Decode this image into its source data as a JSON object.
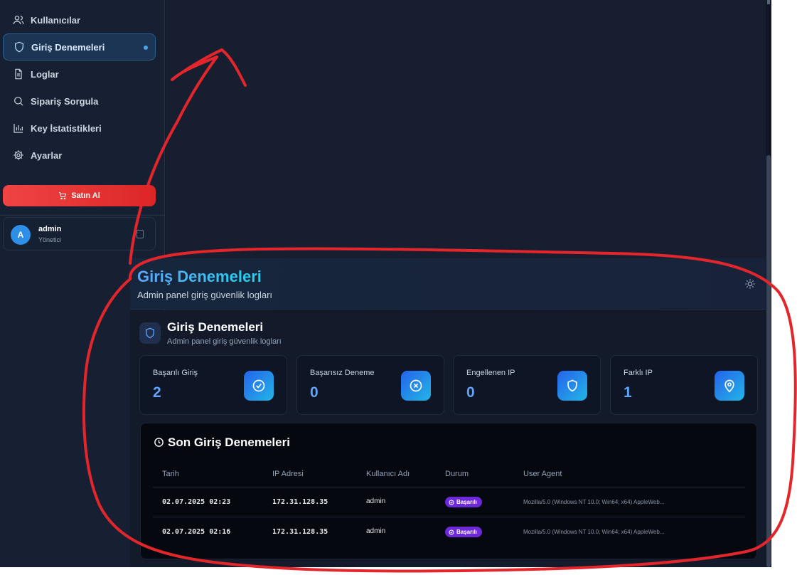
{
  "sidebar": {
    "items": [
      {
        "label": "Kullanıcılar",
        "icon": "users-icon"
      },
      {
        "label": "Giriş Denemeleri",
        "icon": "shield-icon",
        "active": true
      },
      {
        "label": "Loglar",
        "icon": "file-text-icon"
      },
      {
        "label": "Sipariş Sorgula",
        "icon": "search-icon"
      },
      {
        "label": "Key İstatistikleri",
        "icon": "bar-chart-icon"
      },
      {
        "label": "Ayarlar",
        "icon": "gear-icon"
      }
    ],
    "buy_label": "Satın Al",
    "user": {
      "initial": "A",
      "name": "admin",
      "role": "Yönetici"
    }
  },
  "header": {
    "title": "Giriş Denemeleri",
    "subtitle": "Admin panel giriş güvenlik logları"
  },
  "section": {
    "title": "Giriş Denemeleri",
    "subtitle": "Admin panel giriş güvenlik logları"
  },
  "stats": [
    {
      "label": "Başarılı Giriş",
      "value": "2",
      "icon": "check-circle-icon"
    },
    {
      "label": "Başarısız Deneme",
      "value": "0",
      "icon": "x-circle-icon"
    },
    {
      "label": "Engellenen IP",
      "value": "0",
      "icon": "shield-icon"
    },
    {
      "label": "Farklı IP",
      "value": "1",
      "icon": "map-pin-icon"
    }
  ],
  "attempts": {
    "title": "Son Giriş Denemeleri",
    "columns": [
      "Tarih",
      "IP Adresi",
      "Kullanıcı Adı",
      "Durum",
      "User Agent"
    ],
    "rows": [
      {
        "date": "02.07.2025 02:23",
        "ip": "172.31.128.35",
        "user": "admin",
        "status": "Başarılı",
        "agent": "Mozilla/5.0 (Windows NT 10.0; Win64; x64) AppleWeb..."
      },
      {
        "date": "02.07.2025 02:16",
        "ip": "172.31.128.35",
        "user": "admin",
        "status": "Başarılı",
        "agent": "Mozilla/5.0 (Windows NT 10.0; Win64; x64) AppleWeb..."
      }
    ]
  },
  "colors": {
    "accent": "#60a5fa",
    "danger": "#ef4444",
    "badge": "#6d28d9",
    "annotation": "#e3262b"
  }
}
